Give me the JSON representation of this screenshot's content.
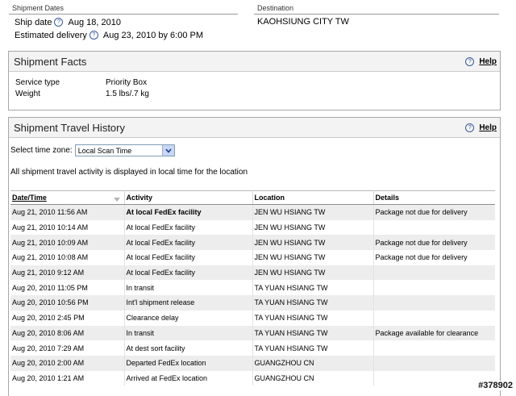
{
  "shipment_dates": {
    "header": "Shipment Dates",
    "ship_date_label": "Ship date",
    "ship_date": "Aug 18, 2010",
    "est_delivery_label": "Estimated delivery",
    "est_delivery": "Aug 23, 2010 by 6:00 PM"
  },
  "destination": {
    "header": "Destination",
    "value": "KAOHSIUNG CITY TW"
  },
  "facts": {
    "title": "Shipment Facts",
    "help": "Help",
    "rows": [
      {
        "label": "Service type",
        "value": "Priority Box"
      },
      {
        "label": "Weight",
        "value": "1.5 lbs/.7 kg"
      }
    ]
  },
  "history": {
    "title": "Shipment Travel History",
    "help": "Help",
    "tz_label": "Select time zone:",
    "tz_value": "Local Scan Time",
    "info": "All shipment travel activity is displayed in local time for the location",
    "columns": [
      "Date/Time",
      "Activity",
      "Location",
      "Details"
    ],
    "rows": [
      [
        "Aug 21, 2010 11:56 AM",
        "At local FedEx facility",
        "JEN WU HSIANG TW",
        "Package not due for delivery"
      ],
      [
        "Aug 21, 2010 10:14 AM",
        "At local FedEx facility",
        "JEN WU HSIANG TW",
        ""
      ],
      [
        "Aug 21, 2010 10:09 AM",
        "At local FedEx facility",
        "JEN WU HSIANG TW",
        "Package not due for delivery"
      ],
      [
        "Aug 21, 2010 10:08 AM",
        "At local FedEx facility",
        "JEN WU HSIANG TW",
        "Package not due for delivery"
      ],
      [
        "Aug 21, 2010 9:12 AM",
        "At local FedEx facility",
        "JEN WU HSIANG TW",
        ""
      ],
      [
        "Aug 20, 2010 11:05 PM",
        "In transit",
        "TA YUAN HSIANG TW",
        ""
      ],
      [
        "Aug 20, 2010 10:56 PM",
        "Int'l shipment release",
        "TA YUAN HSIANG TW",
        ""
      ],
      [
        "Aug 20, 2010 2:45 PM",
        "Clearance delay",
        "TA YUAN HSIANG TW",
        ""
      ],
      [
        "Aug 20, 2010 8:06 AM",
        "In transit",
        "TA YUAN HSIANG TW",
        "Package available for clearance"
      ],
      [
        "Aug 20, 2010 7:29 AM",
        "At dest sort facility",
        "TA YUAN HSIANG TW",
        ""
      ],
      [
        "Aug 20, 2010 2:00 AM",
        "Departed FedEx location",
        "GUANGZHOU CN",
        ""
      ],
      [
        "Aug 20, 2010 1:21 AM",
        "Arrived at FedEx location",
        "GUANGZHOU CN",
        ""
      ]
    ]
  },
  "watermark": "#378902",
  "colors": {
    "help_icon": "#3a5a9a",
    "row_shade": "#ededed",
    "panel_header": "#f3f3f3"
  }
}
